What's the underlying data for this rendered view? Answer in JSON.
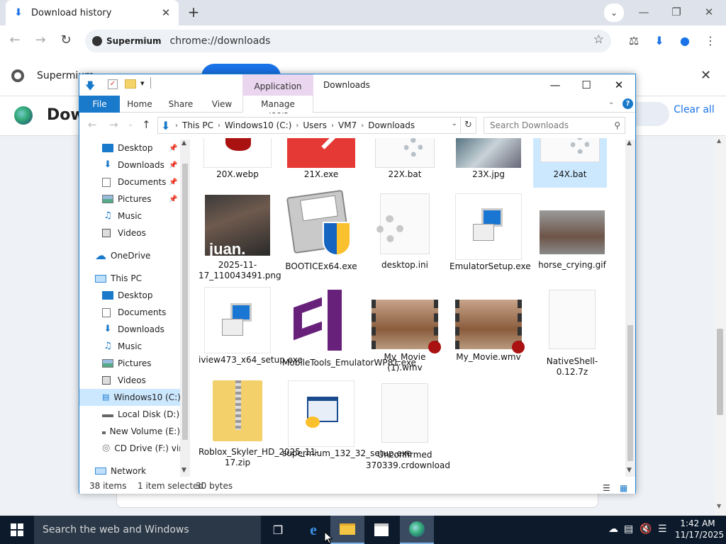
{
  "browser": {
    "tab_title": "Download history",
    "new_tab": "+",
    "site_name": "Supermium",
    "url": "chrome://downloads",
    "infobar_text": "Supermium",
    "page_title": "Dow",
    "clear_all": "Clear all"
  },
  "explorer": {
    "window_title": "Downloads",
    "app_tools": "Application Tools",
    "ribbon_tabs": [
      "File",
      "Home",
      "Share",
      "View",
      "Manage"
    ],
    "breadcrumb": [
      "This PC",
      "Windows10 (C:)",
      "Users",
      "VM7",
      "Downloads"
    ],
    "search_placeholder": "Search Downloads",
    "nav": [
      {
        "label": "Desktop",
        "icon": "desktop-icon",
        "pinned": true
      },
      {
        "label": "Downloads",
        "icon": "downloads-icon",
        "pinned": true
      },
      {
        "label": "Documents",
        "icon": "documents-icon",
        "pinned": true
      },
      {
        "label": "Pictures",
        "icon": "pictures-icon",
        "pinned": true
      },
      {
        "label": "Music",
        "icon": "music-icon",
        "pinned": false
      },
      {
        "label": "Videos",
        "icon": "videos-icon",
        "pinned": false
      },
      {
        "label": "OneDrive",
        "icon": "onedrive-icon",
        "pinned": false
      },
      {
        "label": "This PC",
        "icon": "this-pc-icon",
        "pinned": false
      },
      {
        "label": "Desktop",
        "icon": "desktop-icon",
        "pinned": false
      },
      {
        "label": "Documents",
        "icon": "documents-icon",
        "pinned": false
      },
      {
        "label": "Downloads",
        "icon": "downloads-icon",
        "pinned": false
      },
      {
        "label": "Music",
        "icon": "music-icon",
        "pinned": false
      },
      {
        "label": "Pictures",
        "icon": "pictures-icon",
        "pinned": false
      },
      {
        "label": "Videos",
        "icon": "videos-icon",
        "pinned": false
      },
      {
        "label": "Windows10 (C:)",
        "icon": "drive-c-icon",
        "pinned": false,
        "selected": true
      },
      {
        "label": "Local Disk (D:)",
        "icon": "drive-icon",
        "pinned": false
      },
      {
        "label": "New Volume (E:)",
        "icon": "drive-icon",
        "pinned": false
      },
      {
        "label": "CD Drive (F:) virt",
        "icon": "cd-drive-icon",
        "pinned": false
      },
      {
        "label": "Network",
        "icon": "network-icon",
        "pinned": false
      }
    ],
    "files": [
      {
        "name": "20X.webp",
        "icon": "webp-image-icon"
      },
      {
        "name": "21X.exe",
        "icon": "exe-red-icon"
      },
      {
        "name": "22X.bat",
        "icon": "bat-gear-icon"
      },
      {
        "name": "23X.jpg",
        "icon": "jpg-photo-icon"
      },
      {
        "name": "24X.bat",
        "icon": "bat-gear-icon",
        "selected": true
      },
      {
        "name": "2025-11-17_110043491.png",
        "icon": "png-photo-icon"
      },
      {
        "name": "BOOTICEx64.exe",
        "icon": "floppy-shield-icon"
      },
      {
        "name": "desktop.ini",
        "icon": "ini-gear-icon"
      },
      {
        "name": "EmulatorSetup.exe",
        "icon": "installer-icon"
      },
      {
        "name": "horse_crying.gif",
        "icon": "gif-photo-icon"
      },
      {
        "name": "iview473_x64_setup.exe",
        "icon": "installer-icon"
      },
      {
        "name": "MobileTools_EmulatorWP81.exe",
        "icon": "visual-studio-icon"
      },
      {
        "name": "My_Movie (1).wmv",
        "icon": "video-file-icon"
      },
      {
        "name": "My_Movie.wmv",
        "icon": "video-file-icon"
      },
      {
        "name": "NativeShell-0.12.7z",
        "icon": "blank-file-icon"
      },
      {
        "name": "Roblox_Skyler_HD_2025_11-17.zip",
        "icon": "zip-folder-icon"
      },
      {
        "name": "supermium_132_32_setup.exe",
        "icon": "setup-app-icon"
      },
      {
        "name": "Unconfirmed 370339.crdownload",
        "icon": "blank-file-icon"
      }
    ],
    "status": {
      "items": "38 items",
      "selected": "1 item selected",
      "size": "30 bytes"
    }
  },
  "taskbar": {
    "search_placeholder": "Search the web and Windows",
    "time": "1:42 AM",
    "date": "11/17/2025"
  },
  "colors": {
    "accent": "#1979ca",
    "selection": "#cce8ff",
    "taskbar": "#0c1a2c",
    "app_tools": "#ead6ee"
  }
}
